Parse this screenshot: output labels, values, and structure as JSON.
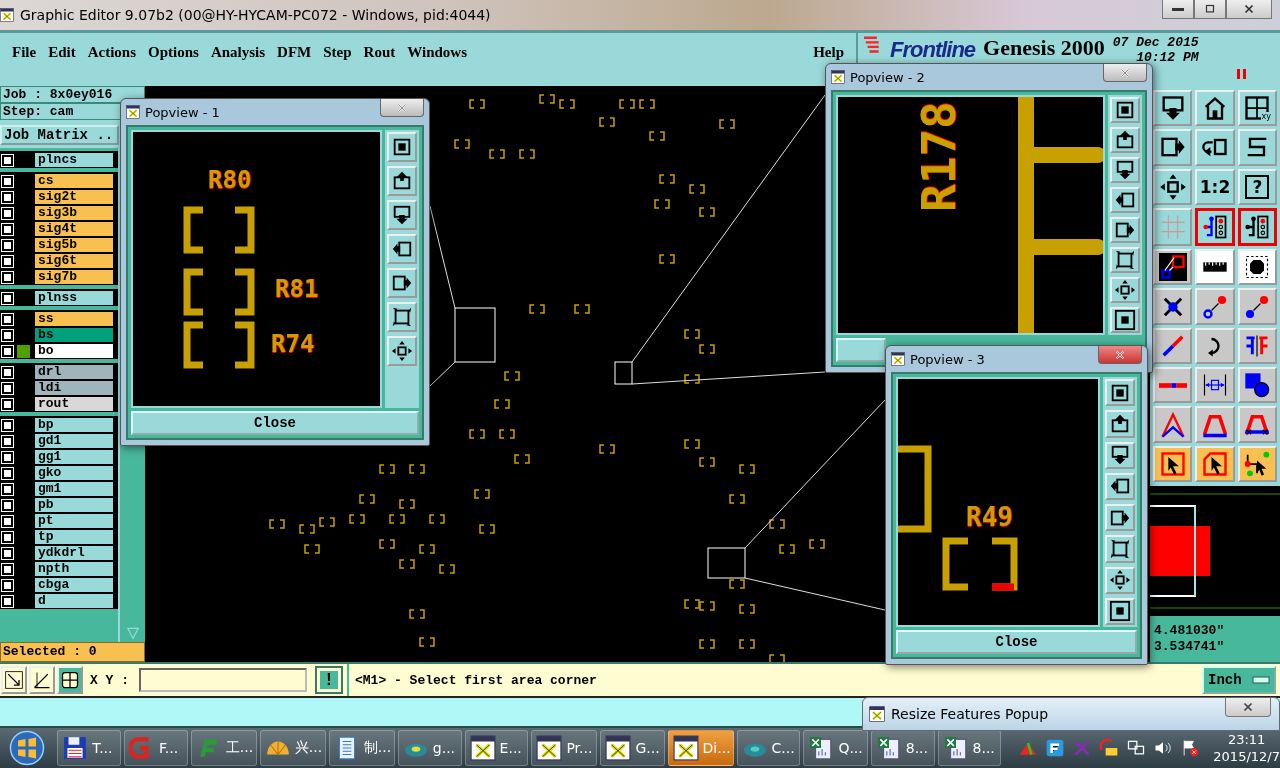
{
  "window": {
    "title": "Graphic Editor 9.07b2 (00@HY-HYCAM-PC072 - Windows, pid:4044)"
  },
  "menu": {
    "items": [
      "File",
      "Edit",
      "Actions",
      "Options",
      "Analysis",
      "DFM",
      "Step",
      "Rout",
      "Windows"
    ],
    "help": "Help"
  },
  "brand": {
    "logo": "Frontline",
    "product": "Genesis 2000",
    "date": "07 Dec 2015",
    "time": "10:12 PM"
  },
  "job": {
    "job": "Job : 8x0ey016",
    "step": "Step: cam",
    "matrix_button": "Job Matrix .."
  },
  "layers": {
    "groups": [
      {
        "items": [
          {
            "name": "plncs",
            "color": "#9ad9d9",
            "checked": false,
            "affected": false
          }
        ]
      },
      {
        "items": [
          {
            "name": "cs",
            "color": "#f8c050",
            "checked": false,
            "affected": false
          },
          {
            "name": "sig2t",
            "color": "#f8c050",
            "checked": false,
            "affected": false
          },
          {
            "name": "sig3b",
            "color": "#f8c050",
            "checked": false,
            "affected": false
          },
          {
            "name": "sig4t",
            "color": "#f8c050",
            "checked": false,
            "affected": false
          },
          {
            "name": "sig5b",
            "color": "#f8c050",
            "checked": false,
            "affected": false
          },
          {
            "name": "sig6t",
            "color": "#f8c050",
            "checked": false,
            "affected": false
          },
          {
            "name": "sig7b",
            "color": "#f8c050",
            "checked": false,
            "affected": false
          }
        ]
      },
      {
        "items": [
          {
            "name": "plnss",
            "color": "#9ad9d9",
            "checked": false,
            "affected": false
          }
        ]
      },
      {
        "items": [
          {
            "name": "ss",
            "color": "#f8c050",
            "checked": false,
            "affected": false
          },
          {
            "name": "bs",
            "color": "#00a07c",
            "checked": false,
            "affected": false
          },
          {
            "name": "bo",
            "color": "#ffffff",
            "checked": false,
            "affected": true
          }
        ]
      },
      {
        "items": [
          {
            "name": "drl",
            "color": "#a0b4bc",
            "checked": false,
            "affected": false
          },
          {
            "name": "ldi",
            "color": "#a0b4bc",
            "checked": false,
            "affected": false
          },
          {
            "name": "rout",
            "color": "#d8d8d8",
            "checked": false,
            "affected": false
          }
        ]
      },
      {
        "items": [
          {
            "name": "bp",
            "color": "#9ad9d9",
            "checked": false,
            "affected": false
          },
          {
            "name": "gd1",
            "color": "#9ad9d9",
            "checked": false,
            "affected": false
          },
          {
            "name": "gg1",
            "color": "#9ad9d9",
            "checked": false,
            "affected": false
          },
          {
            "name": "gko",
            "color": "#9ad9d9",
            "checked": false,
            "affected": false
          },
          {
            "name": "gm1",
            "color": "#9ad9d9",
            "checked": false,
            "affected": false
          },
          {
            "name": "pb",
            "color": "#9ad9d9",
            "checked": false,
            "affected": false
          },
          {
            "name": "pt",
            "color": "#9ad9d9",
            "checked": false,
            "affected": false
          },
          {
            "name": "tp",
            "color": "#9ad9d9",
            "checked": false,
            "affected": false
          },
          {
            "name": "ydkdrl",
            "color": "#9ad9d9",
            "checked": false,
            "affected": false
          },
          {
            "name": "npth",
            "color": "#9ad9d9",
            "checked": false,
            "affected": false
          },
          {
            "name": "cbga",
            "color": "#9ad9d9",
            "checked": false,
            "affected": false
          },
          {
            "name": "d",
            "color": "#9ad9d9",
            "checked": false,
            "affected": false
          }
        ]
      }
    ],
    "selected_count": "Selected : 0"
  },
  "toolbox": [
    {
      "selected": false
    },
    {
      "selected": false
    },
    {
      "selected": false,
      "glyph": "xy"
    },
    {
      "selected": false
    },
    {
      "selected": false
    },
    {
      "selected": false
    },
    {
      "selected": false
    },
    {
      "selected": false,
      "glyph": "1:2"
    },
    {
      "selected": false,
      "glyph": "?"
    },
    {
      "selected": false
    },
    {
      "selected": true
    },
    {
      "selected": true
    },
    {
      "selected": false
    },
    {
      "selected": false
    },
    {
      "selected": false
    },
    {
      "selected": false
    },
    {
      "selected": false
    },
    {
      "selected": false
    },
    {
      "selected": false
    },
    {
      "selected": false
    },
    {
      "selected": false
    },
    {
      "selected": false
    },
    {
      "selected": false
    },
    {
      "selected": false
    },
    {
      "selected": false
    },
    {
      "selected": false
    },
    {
      "selected": false
    },
    {
      "selected": false
    },
    {
      "selected": false
    },
    {
      "selected": false
    }
  ],
  "coordinates": {
    "x": "4.481030\"",
    "y": "3.534741\""
  },
  "popviews": [
    {
      "title": "Popview - 1",
      "labels": [
        "R80",
        "R81",
        "R74"
      ],
      "close_label": "Close"
    },
    {
      "title": "Popview - 2",
      "labels": [
        "R178"
      ]
    },
    {
      "title": "Popview - 3",
      "labels": [
        "R49"
      ],
      "close_label": "Close"
    }
  ],
  "command": {
    "xy_label": "X Y :",
    "alert_glyph": "!",
    "prompt": "<M1> - Select first area corner",
    "units": "Inch"
  },
  "resize_popup": {
    "title": "Resize Features Popup"
  },
  "taskbar": {
    "items": [
      {
        "label": "T...",
        "selected": false
      },
      {
        "label": "F...",
        "selected": false
      },
      {
        "label": "工...",
        "selected": false
      },
      {
        "label": "兴...",
        "selected": false
      },
      {
        "label": "制...",
        "selected": false
      },
      {
        "label": "g...",
        "selected": false
      },
      {
        "label": "E...",
        "selected": false
      },
      {
        "label": "Pr...",
        "selected": false
      },
      {
        "label": "G...",
        "selected": false
      },
      {
        "label": "Di...",
        "selected": true
      },
      {
        "label": "C...",
        "selected": false
      },
      {
        "label": "Q...",
        "selected": false
      },
      {
        "label": "8...",
        "selected": false
      },
      {
        "label": "8...",
        "selected": false
      }
    ],
    "time": "23:11",
    "date": "2015/12/7"
  }
}
